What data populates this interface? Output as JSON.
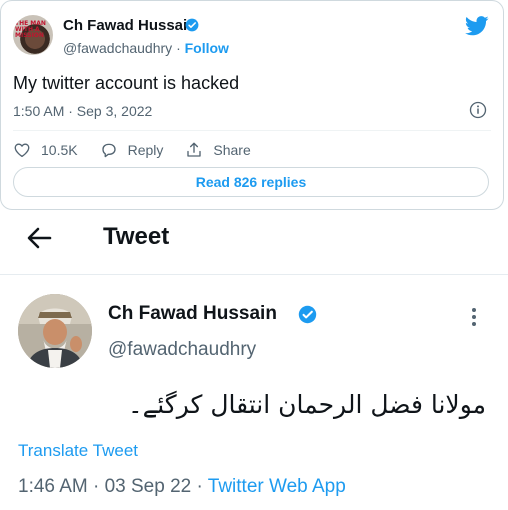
{
  "embed": {
    "author_name": "Ch Fawad Hussain",
    "handle": "@fawadchaudhry",
    "separator": "·",
    "follow_label": "Follow",
    "avatar_text": "THE MAN WITH A MISSION",
    "tweet_text": "My twitter account is hacked",
    "timestamp": "1:50 AM · Sep 3, 2022",
    "likes_count": "10.5K",
    "reply_label": "Reply",
    "share_label": "Share",
    "read_replies_label": "Read 826 replies"
  },
  "page": {
    "title": "Tweet"
  },
  "tweet": {
    "author_name": "Ch Fawad Hussain",
    "handle": "@fawadchaudhry",
    "text": "مولانا فضل الرحمان انتقال کرگئے۔",
    "translate_label": "Translate Tweet",
    "timestamp": "1:46 AM · 03 Sep 22 · ",
    "source_app": "Twitter Web App"
  },
  "colors": {
    "accent": "#1d9bf0",
    "text": "#0f1419",
    "muted": "#536471"
  }
}
